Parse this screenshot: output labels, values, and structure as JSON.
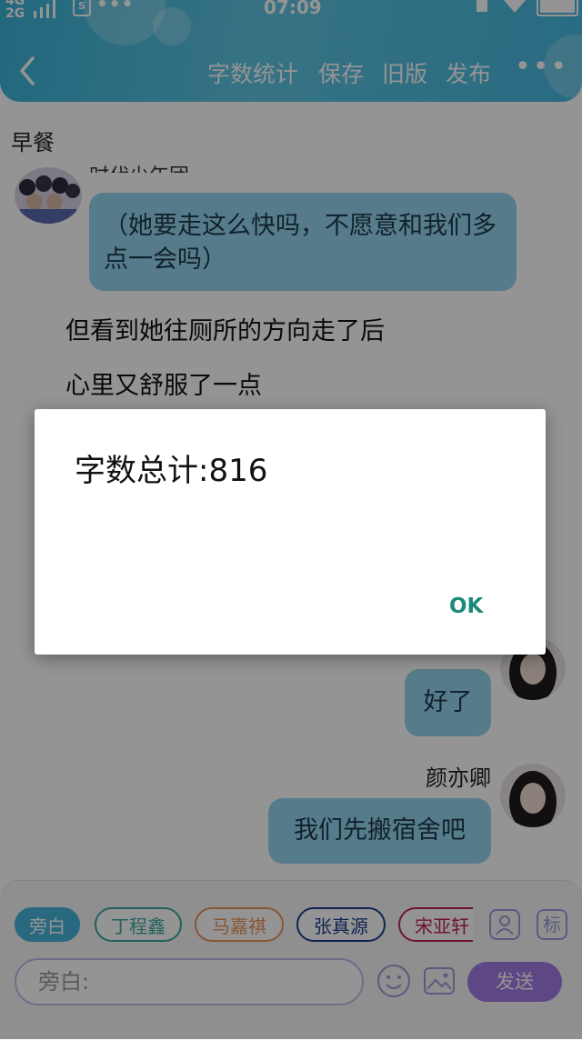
{
  "status_bar": {
    "network_top": "4G",
    "network_bottom": "2G",
    "app_badge": "S",
    "dots": "•••",
    "time": "07:09"
  },
  "header": {
    "back_icon": "chevron-left-icon",
    "nav": [
      "字数统计",
      "保存",
      "旧版",
      "发布"
    ],
    "more": "•••"
  },
  "page_title": "早餐",
  "chat": {
    "top_cut_name": "时代少年团",
    "left_bubble": "（她要走这么快吗，不愿意和我们多点一会吗）",
    "narration_1": "但看到她往厕所的方向走了后",
    "narration_2": "心里又舒服了一点",
    "right_bubble_1": "好了",
    "right_name_2": "颜亦卿",
    "right_bubble_2": "我们先搬宿舍吧"
  },
  "input_bar": {
    "chips": [
      {
        "label": "旁白",
        "active": true,
        "color": "#45b6dc"
      },
      {
        "label": "丁程鑫",
        "active": false,
        "color": "#3aa8a0"
      },
      {
        "label": "马嘉祺",
        "active": false,
        "color": "#e9945a"
      },
      {
        "label": "张真源",
        "active": false,
        "color": "#1d3f8c"
      },
      {
        "label": "宋亚轩",
        "active": false,
        "color": "#c0225a"
      }
    ],
    "person_icon": "person-icon",
    "tag_label": "标",
    "placeholder": "旁白:",
    "emoji_icon": "emoji-icon",
    "image_icon": "image-icon",
    "send_label": "发送"
  },
  "dialog": {
    "message": "字数总计:816",
    "ok_label": "OK"
  },
  "colors": {
    "header": "#46b8df",
    "bubble": "#94d4ef",
    "send": "#a37be5",
    "ok": "#1b8a7a"
  }
}
